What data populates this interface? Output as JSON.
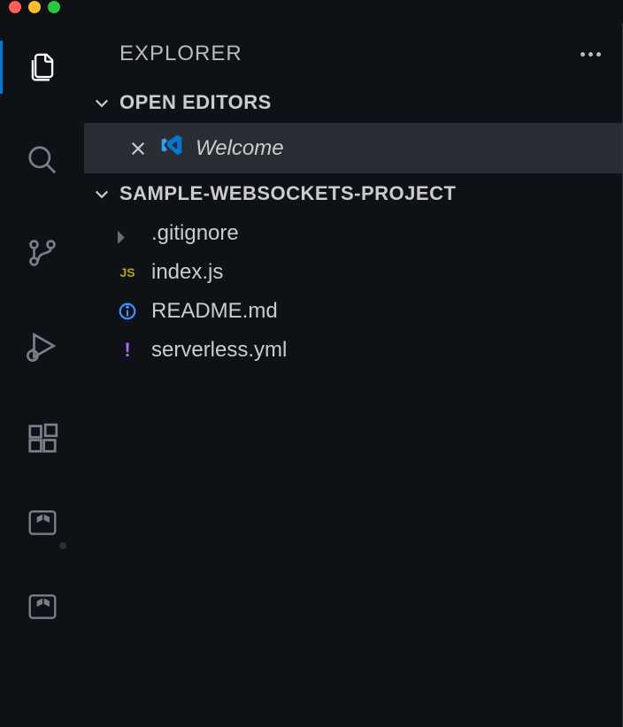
{
  "sidebar": {
    "title": "EXPLORER"
  },
  "sections": {
    "open_editors": {
      "label": "OPEN EDITORS"
    },
    "project": {
      "label": "SAMPLE-WEBSOCKETS-PROJECT"
    }
  },
  "open_editor": {
    "label": "Welcome"
  },
  "files": {
    "0": {
      "name": ".gitignore"
    },
    "1": {
      "name": "index.js"
    },
    "2": {
      "name": "README.md"
    },
    "3": {
      "name": "serverless.yml"
    }
  },
  "js_badge": "JS"
}
